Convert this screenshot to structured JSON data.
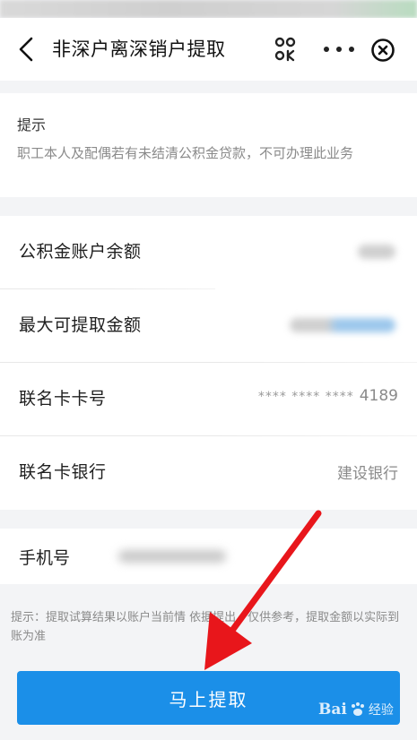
{
  "navbar": {
    "title": "非深户离深销户提取"
  },
  "tip": {
    "title": "提示",
    "text": "职工本人及配偶若有未结清公积金贷款，不可办理此业务"
  },
  "rows": [
    {
      "label": "公积金账户余额",
      "value": ""
    },
    {
      "label": "最大可提取金额",
      "value": ""
    },
    {
      "label": "联名卡卡号",
      "mask": "**** **** ****",
      "value": "4189"
    },
    {
      "label": "联名卡银行",
      "value": "建设银行"
    }
  ],
  "phone": {
    "label": "手机号"
  },
  "bottom_note": "提示：提取试算结果以账户当前情        依据提出，仅供参考，提取金额以实际到账为准",
  "submit": {
    "label": "马上提取"
  },
  "watermark": {
    "brand": "Bai",
    "suffix": "经验"
  },
  "colors": {
    "accent": "#1b8fe8",
    "arrow": "#e8161b"
  },
  "icons": {
    "back": "chevron-left-icon",
    "scan": "scan-icon",
    "more": "more-dots-icon",
    "close": "close-circle-icon"
  }
}
